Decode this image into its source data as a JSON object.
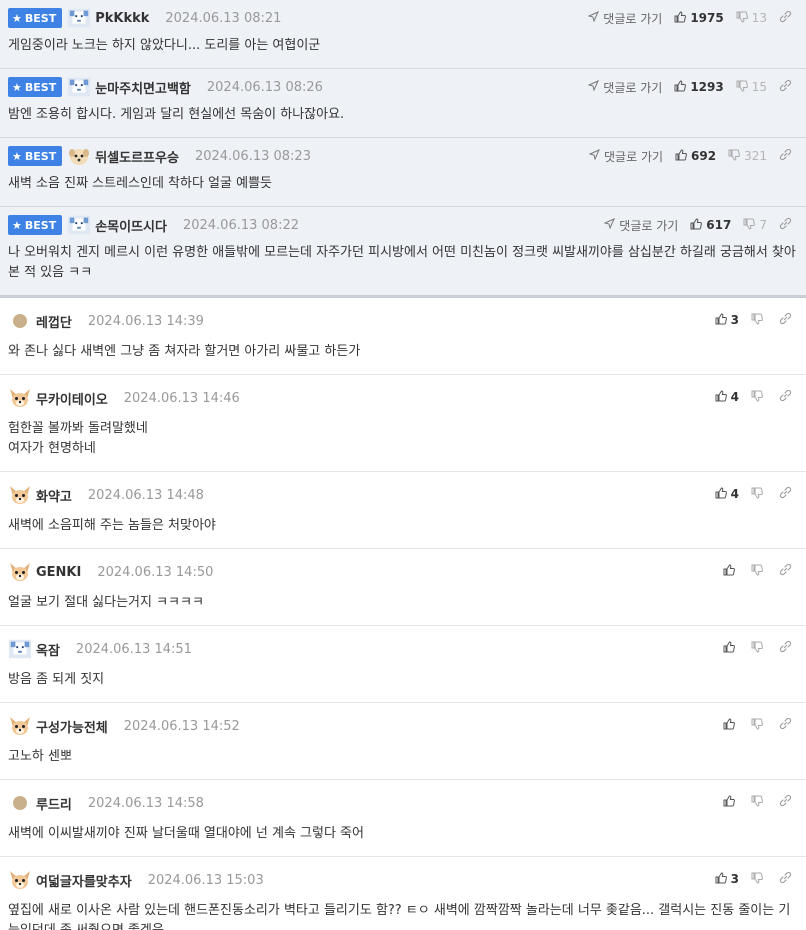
{
  "best_label": "BEST",
  "goto_label": "댓글로 가기",
  "best_comments": [
    {
      "nick": "PkKkkk",
      "date": "2024.06.13 08:21",
      "text": "게임중이라 노크는 하지 않았다니... 도리를 아는 여협이군",
      "up": "1975",
      "down": "13",
      "avatar": "pixel-avatar"
    },
    {
      "nick": "눈마주치면고백함",
      "date": "2024.06.13 08:26",
      "text": "밤엔 조용히 합시다. 게임과 달리 현실에선 목숨이 하나잖아요.",
      "up": "1293",
      "down": "15",
      "avatar": "pixel-avatar"
    },
    {
      "nick": "뒤셀도르프우승",
      "date": "2024.06.13 08:23",
      "text": "새벽 소음 진짜 스트레스인데 착하다 얼굴 예쁠듯",
      "up": "692",
      "down": "321",
      "avatar": "dog-avatar"
    },
    {
      "nick": "손목이뜨시다",
      "date": "2024.06.13 08:22",
      "text": "나 오버워치 겐지 메르시 이런 유명한 애들밖에 모르는데 자주가던 피시방에서 어떤 미친놈이 정크랫 씨발새끼야를 삼십분간 하길래 궁금해서 찾아본 적 있음 ㅋㅋ",
      "up": "617",
      "down": "7",
      "avatar": "pixel-avatar"
    }
  ],
  "comments": [
    {
      "nick": "레껍단",
      "date": "2024.06.13 14:39",
      "text": "와 존나 싫다 새벽엔 그냥 좀 쳐자라 할거면 아가리 싸물고 하든가",
      "up": "3",
      "avatar": "dot-avatar"
    },
    {
      "nick": "무카이테이오",
      "date": "2024.06.13 14:46",
      "text": "험한꼴 볼까봐 돌려말했네\n여자가 현명하네",
      "up": "4",
      "avatar": "chihuahua-avatar"
    },
    {
      "nick": "화약고",
      "date": "2024.06.13 14:48",
      "text": "새벽에 소음피해 주는 놈들은 처맞아야",
      "up": "4",
      "avatar": "chihuahua-avatar"
    },
    {
      "nick": "GENKI",
      "date": "2024.06.13 14:50",
      "text": "얼굴 보기 절대 싫다는거지 ㅋㅋㅋㅋ",
      "up": "",
      "avatar": "chihuahua-avatar"
    },
    {
      "nick": "옥잠",
      "date": "2024.06.13 14:51",
      "text": "방음 좀 되게 짓지",
      "up": "",
      "avatar": "pixel-avatar"
    },
    {
      "nick": "구성가능전체",
      "date": "2024.06.13 14:52",
      "text": "고노하 센뽀",
      "up": "",
      "avatar": "chihuahua-avatar"
    },
    {
      "nick": "루드리",
      "date": "2024.06.13 14:58",
      "text": "새벽에 이씨발새끼야 진짜 날더울때 열대야에 넌 계속 그렇다 죽어",
      "up": "",
      "avatar": "dot-avatar"
    },
    {
      "nick": "여덟글자를맞추자",
      "date": "2024.06.13 15:03",
      "text": "옆집에 새로 이사온 사람 있는데 핸드폰진동소리가 벽타고 들리기도 함?? ㅌㅇ 새벽에 깜짝깜짝 놀라는데 너무 좆같음... 갤럭시는 진동 줄이는 기능있던데 좀 써줬으면 좋겠음",
      "up": "3",
      "avatar": "chihuahua-avatar"
    }
  ],
  "colors": {
    "best_badge": "#3d82e4",
    "best_bg": "#eef1f6"
  }
}
